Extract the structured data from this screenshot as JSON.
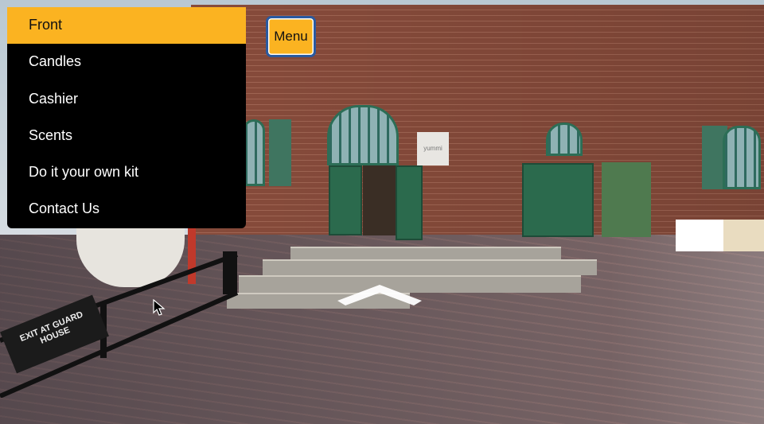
{
  "menu": {
    "items": [
      {
        "label": "Front",
        "active": true
      },
      {
        "label": "Candles",
        "active": false
      },
      {
        "label": "Cashier",
        "active": false
      },
      {
        "label": "Scents",
        "active": false
      },
      {
        "label": "Do it your own kit",
        "active": false
      },
      {
        "label": "Contact Us",
        "active": false
      }
    ],
    "toggle_label": "Menu"
  },
  "scene": {
    "sign_text": "EXIT AT GUARD HOUSE",
    "store_sign": "yummi",
    "nav_arrow": "chevron-up-icon"
  },
  "colors": {
    "accent": "#fbb321",
    "menu_bg": "#000000",
    "button_border": "#2a5aa0"
  }
}
